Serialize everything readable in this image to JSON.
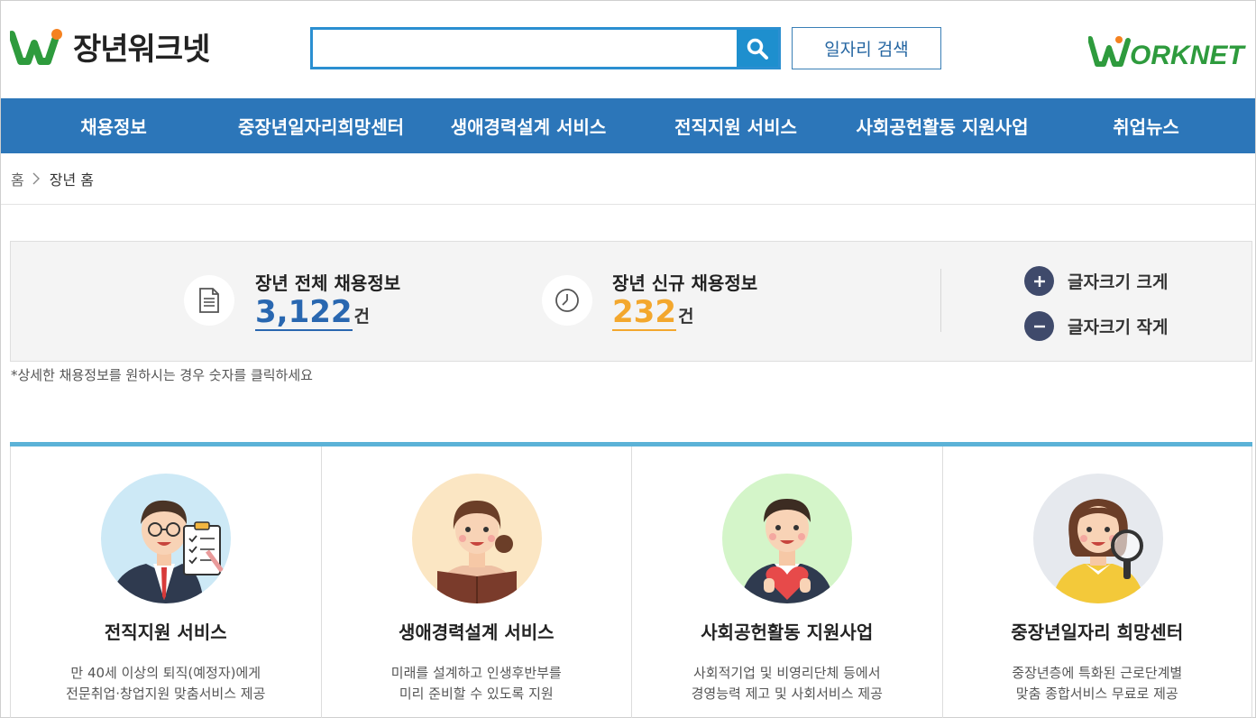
{
  "header": {
    "logo_text": "장년워크넷",
    "search_placeholder": "",
    "job_search_label": "일자리 검색",
    "worknet_logo": "ORKNET"
  },
  "gnb": [
    "채용정보",
    "중장년일자리희망센터",
    "생애경력설계 서비스",
    "전직지원 서비스",
    "사회공헌활동 지원사업",
    "취업뉴스"
  ],
  "breadcrumb": {
    "home": "홈",
    "current": "장년 홈"
  },
  "stats": {
    "total": {
      "title": "장년 전체 채용정보",
      "value": "3,122",
      "unit": "건"
    },
    "new": {
      "title": "장년 신규 채용정보",
      "value": "232",
      "unit": "건"
    },
    "font_larger": "글자크기 크게",
    "font_smaller": "글자크기 작게",
    "note": "*상세한 채용정보를 원하시는 경우 숫자를 클릭하세요"
  },
  "services": [
    {
      "title": "전직지원 서비스",
      "desc1": "만 40세 이상의 퇴직(예정자)에게",
      "desc2": "전문취업·창업지원 맞춤서비스 제공"
    },
    {
      "title": "생애경력설계 서비스",
      "desc1": "미래를 설계하고 인생후반부를",
      "desc2": "미리 준비할 수 있도록 지원"
    },
    {
      "title": "사회공헌활동 지원사업",
      "desc1": "사회적기업 및 비영리단체 등에서",
      "desc2": "경영능력 제고 및 사회서비스 제공"
    },
    {
      "title": "중장년일자리 희망센터",
      "desc1": "중장년층에 특화된 근로단계별",
      "desc2": "맞춤 종합서비스 무료로 제공"
    }
  ],
  "colors": {
    "nav": "#2c76b9",
    "accent": "#1e8fce",
    "blue_num": "#2967b0",
    "orange_num": "#f3a72d",
    "card_top": "#5bb2d7"
  }
}
